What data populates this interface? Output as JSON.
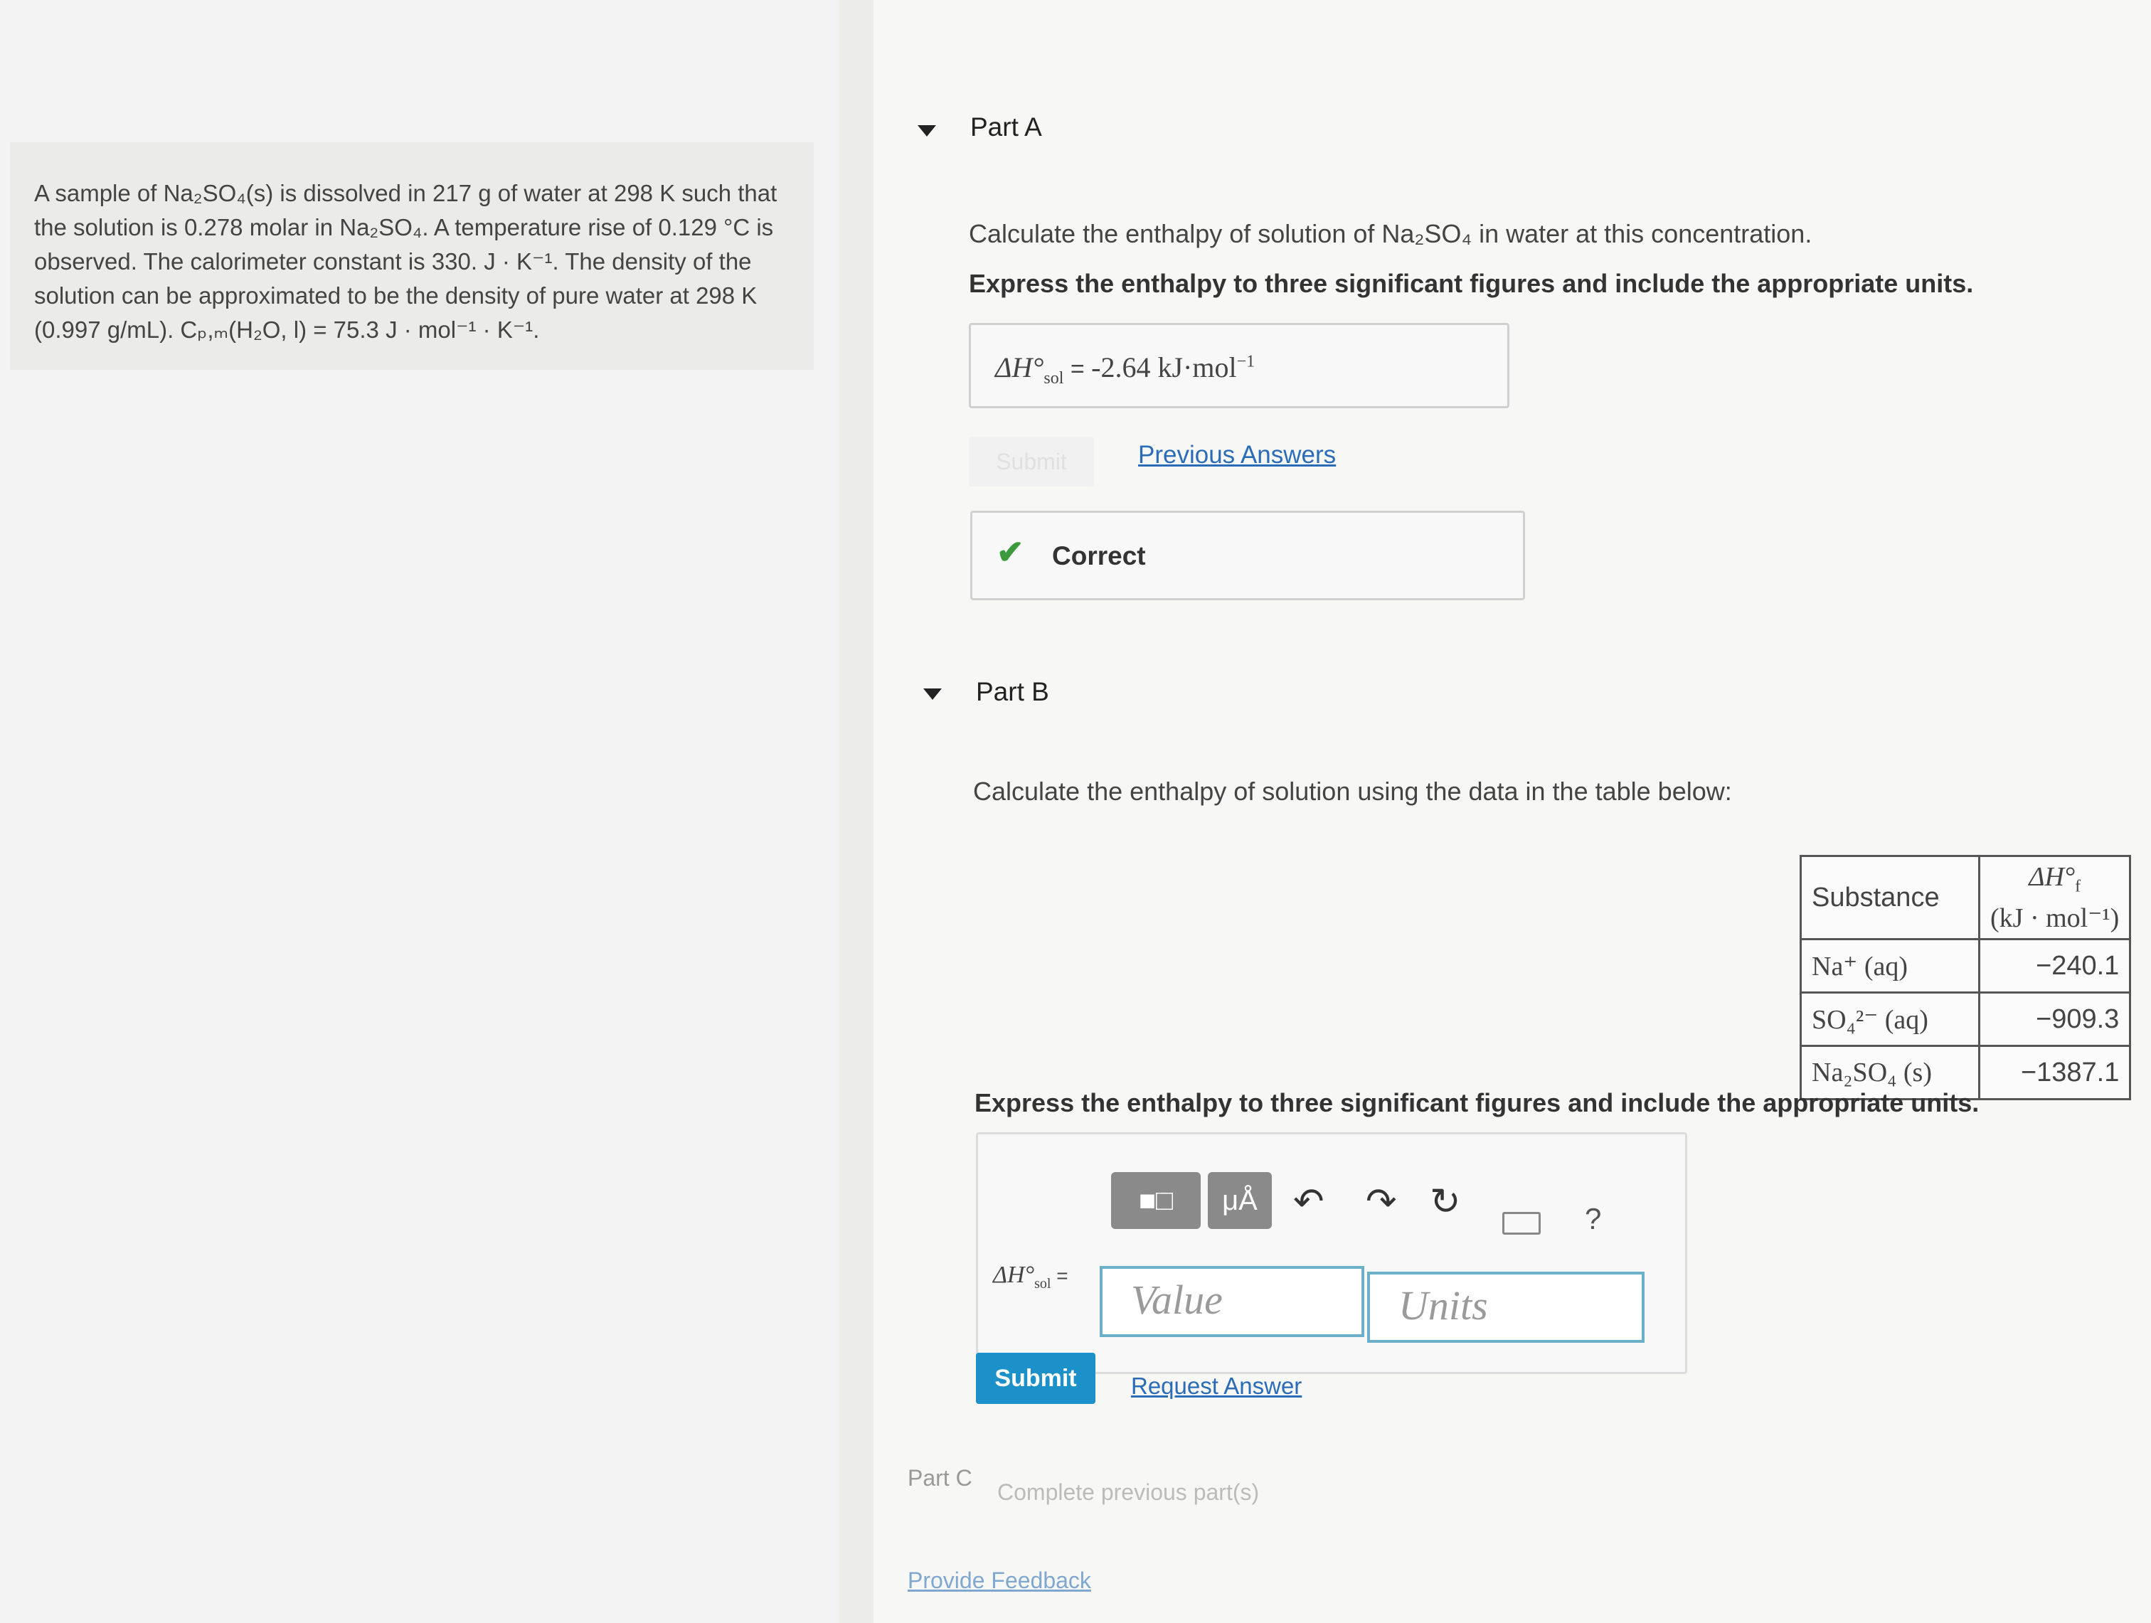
{
  "problem": {
    "lines": [
      "A sample of Na₂SO₄(s) is dissolved in 217 g of water at 298 K such that",
      "the solution is 0.278 molar in Na₂SO₄. A temperature rise of 0.129 °C is",
      "observed. The calorimeter constant is 330. J · K⁻¹. The density of the",
      "solution can be approximated to be the density of pure water at 298 K",
      "(0.997 g/mL). Cₚ,ₘ(H₂O, l) = 75.3 J · mol⁻¹ · K⁻¹."
    ]
  },
  "partA": {
    "title": "Part A",
    "question": "Calculate the enthalpy of solution of Na₂SO₄ in water at this concentration.",
    "instruction": "Express the enthalpy to three significant figures and include the appropriate units.",
    "answer_label": "ΔH°",
    "answer_sub": "sol",
    "answer_eq": " = ",
    "answer_value": "-2.64 kJ·mol",
    "answer_exp": "−1",
    "submit_label": "Submit",
    "previous_answers": "Previous Answers",
    "feedback": "Correct"
  },
  "partB": {
    "title": "Part B",
    "question": "Calculate the enthalpy of solution using the data in the table below:",
    "table": {
      "header_substance": "Substance",
      "header_dh": "ΔH°",
      "header_dh_sub": "f",
      "header_units": "(kJ · mol⁻¹)",
      "rows": [
        {
          "substance": "Na⁺ (aq)",
          "value": "−240.1"
        },
        {
          "substance": "SO₄²⁻ (aq)",
          "value": "−909.3"
        },
        {
          "substance": "Na₂SO₄ (s)",
          "value": "−1387.1"
        }
      ]
    },
    "instruction": "Express the enthalpy to three significant figures and include the appropriate units.",
    "templates_label": "■□",
    "units_label": "μÅ",
    "help_label": "?",
    "input_label": "ΔH°",
    "input_sub": "sol",
    "input_eq": " =",
    "value_placeholder": "Value",
    "units_placeholder": "Units",
    "submit_label": "Submit",
    "request_answer": "Request Answer"
  },
  "partC": {
    "label": "Part C",
    "status": "Complete previous part(s)"
  },
  "feedback_link": "Provide Feedback"
}
